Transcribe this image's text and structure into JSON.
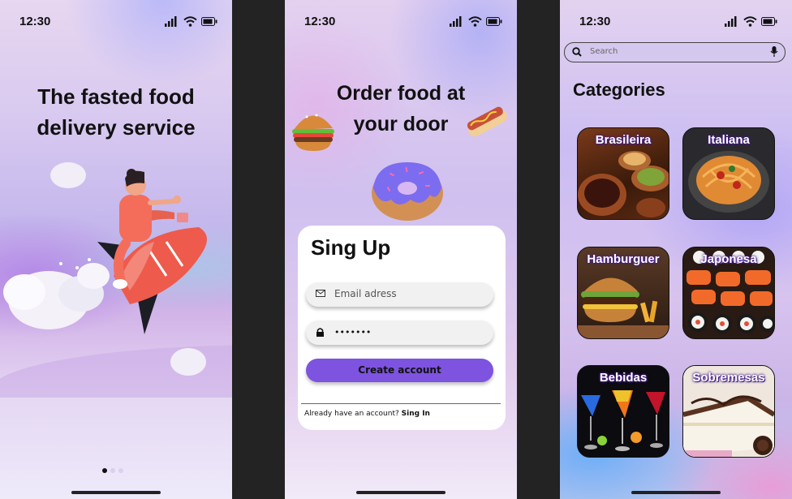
{
  "screen1": {
    "time": "12:30",
    "headline_line1": "The fasted food",
    "headline_line2": "delivery service",
    "pager": {
      "count": 3,
      "active": 1
    }
  },
  "screen2": {
    "time": "12:30",
    "headline_line1": "Order food at",
    "headline_line2": "your door",
    "form": {
      "title": "Sing Up",
      "email_placeholder": "Email adress",
      "password_value": "•••••••",
      "create_button": "Create account",
      "already_text": "Already have an account?",
      "signin_link": "Sing In"
    }
  },
  "screen3": {
    "time": "12:30",
    "search_placeholder": "Search",
    "title": "Categories",
    "categories": [
      {
        "label": "Brasileira"
      },
      {
        "label": "Italiana"
      },
      {
        "label": "Hamburguer"
      },
      {
        "label": "Japonesa"
      },
      {
        "label": "Bebidas"
      },
      {
        "label": "Sobremesas"
      }
    ]
  },
  "colors": {
    "accent": "#7d53e0",
    "frame_bg": "#232323"
  },
  "icons": [
    "signal-icon",
    "wifi-icon",
    "battery-icon",
    "search-icon",
    "mic-icon",
    "mail-icon",
    "lock-icon"
  ]
}
